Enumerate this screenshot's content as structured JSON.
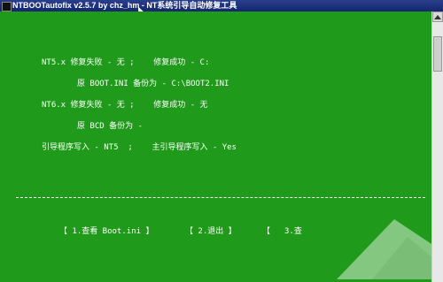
{
  "window": {
    "title": "NTBOOTautofix v2.5.7 by chz_hm - NT系统引导自动修复工具"
  },
  "console": {
    "lines": {
      "nt5_status": "NT5.x 修复失败 - 无 ;    修复成功 - C:",
      "nt5_backup": "原 BOOT.INI 备份为 - C:\\BOOT2.INI",
      "nt6_status": "NT6.x 修复失败 - 无 ;    修复成功 - 无",
      "nt6_backup": "原 BCD 备份为 -",
      "bootloader": "引导程序写入 - NT5  ;    主引导程序写入 - Yes"
    },
    "menu": {
      "item1": "【 1.查看 Boot.ini 】",
      "item2": "【 2.退出 】",
      "item3_bracket": "【",
      "item3_label": "3.查"
    }
  },
  "colors": {
    "console_background": "#1f9a1a",
    "text": "#ffffff"
  },
  "icons": [
    "system-menu-icon",
    "scroll-up-arrow-icon"
  ]
}
